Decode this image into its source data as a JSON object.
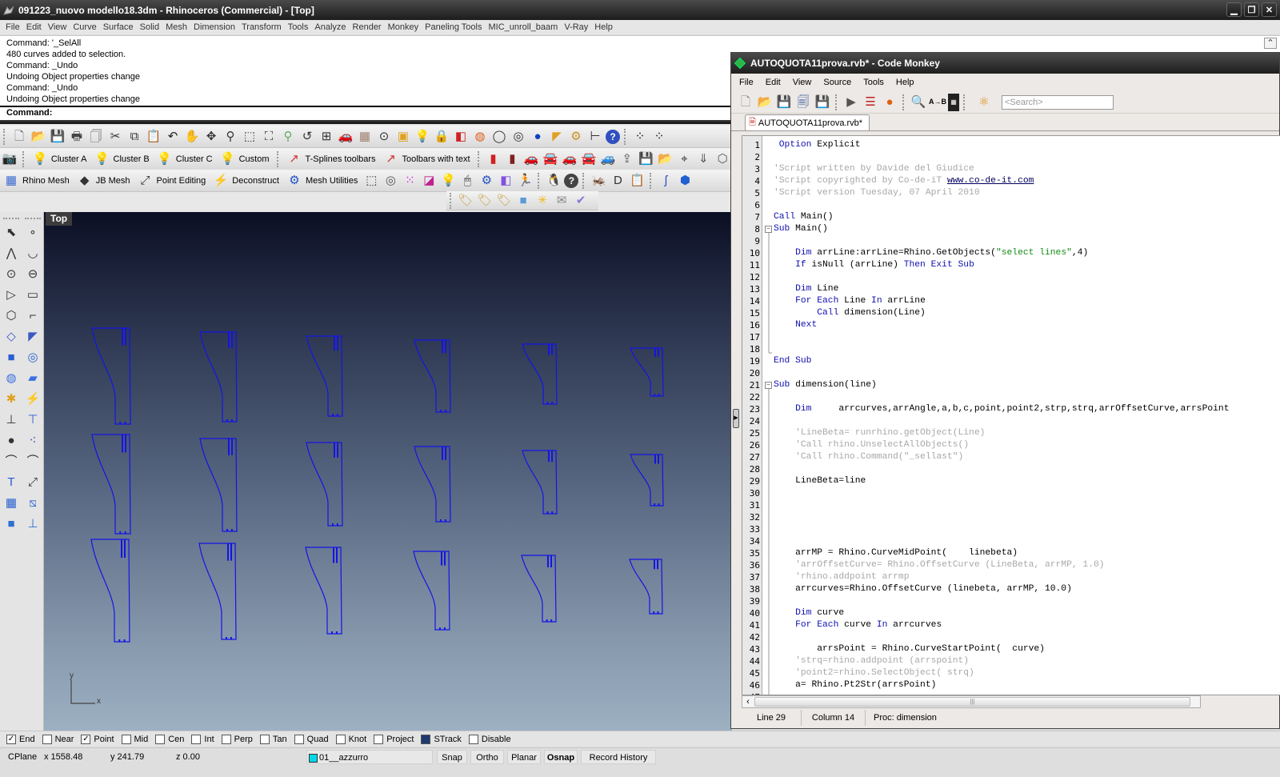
{
  "window": {
    "title": "091223_nuovo modello18.3dm - Rhinoceros (Commercial) - [Top]",
    "controls": [
      "minimize",
      "restore",
      "close"
    ]
  },
  "menu": [
    "File",
    "Edit",
    "View",
    "Curve",
    "Surface",
    "Solid",
    "Mesh",
    "Dimension",
    "Transform",
    "Tools",
    "Analyze",
    "Render",
    "Monkey",
    "Paneling Tools",
    "MIC_unroll_baam",
    "V-Ray",
    "Help"
  ],
  "command_history": [
    "Command: '_SelAll",
    "480 curves added to selection.",
    "Command: _Undo",
    "Undoing Object properties change",
    "Command: _Undo",
    "Undoing Object properties change"
  ],
  "command_prompt": "Command:",
  "toolbars": {
    "row1_icons": [
      "new-file",
      "open",
      "save",
      "print",
      "import",
      "cut",
      "copy",
      "paste",
      "undo",
      "pan",
      "rotate-view",
      "zoom-dynamic",
      "zoom-window",
      "zoom-extents",
      "zoom-selected",
      "undo-view",
      "four-viewports",
      "car",
      "grid",
      "osnap",
      "layer",
      "light-bulb",
      "lock",
      "shade",
      "color-wheel",
      "sphere-wire",
      "sphere-grid",
      "render-sphere",
      "flag",
      "gear",
      "dimension",
      "help"
    ],
    "row2_buttons": [
      {
        "icon": "bulb",
        "label": "Cluster A"
      },
      {
        "icon": "bulb",
        "label": "Cluster B"
      },
      {
        "icon": "bulb",
        "label": "Cluster C"
      },
      {
        "icon": "bulb",
        "label": "Custom"
      },
      {
        "icon": "tsplines",
        "label": "T-Splines toolbars"
      },
      {
        "icon": "tsplines",
        "label": "Toolbars with text"
      }
    ],
    "row3_buttons": [
      {
        "icon": "mesh-cube",
        "label": "Rhino Mesh"
      },
      {
        "icon": "jb-mesh",
        "label": "JB Mesh"
      },
      {
        "icon": "point-edit",
        "label": "Point Editing"
      },
      {
        "icon": "deconstruct",
        "label": "Deconstruct"
      },
      {
        "icon": "gears",
        "label": "Mesh Utilities"
      }
    ]
  },
  "viewport": {
    "label": "Top",
    "axis_x": "x",
    "axis_y": "y",
    "curve_color": "#1414e6",
    "grid_rows": 3,
    "grid_cols": 6
  },
  "osnaps": [
    {
      "label": "End",
      "checked": true
    },
    {
      "label": "Near",
      "checked": false
    },
    {
      "label": "Point",
      "checked": true
    },
    {
      "label": "Mid",
      "checked": false
    },
    {
      "label": "Cen",
      "checked": false
    },
    {
      "label": "Int",
      "checked": false
    },
    {
      "label": "Perp",
      "checked": false
    },
    {
      "label": "Tan",
      "checked": false
    },
    {
      "label": "Quad",
      "checked": false
    },
    {
      "label": "Knot",
      "checked": false
    },
    {
      "label": "Project",
      "checked": false
    },
    {
      "label": "STrack",
      "checked": true
    },
    {
      "label": "Disable",
      "checked": false
    }
  ],
  "status": {
    "cplane": "CPlane",
    "x": "x 1558.48",
    "y": "y 241.79",
    "z": "z 0.00",
    "layer": "01__azzurro",
    "layer_color": "#00d8e8",
    "snap": "Snap",
    "ortho": "Ortho",
    "planar": "Planar",
    "osnap": "Osnap",
    "record_history": "Record History"
  },
  "code_monkey": {
    "title": "AUTOQUOTA11prova.rvb* - Code Monkey",
    "menu": [
      "File",
      "Edit",
      "View",
      "Source",
      "Tools",
      "Help"
    ],
    "search_placeholder": "<Search>",
    "tab": "AUTOQUOTA11prova.rvb*",
    "status": {
      "line": "Line 29",
      "column": "Column 14",
      "proc": "Proc: dimension"
    },
    "lines": [
      {
        "n": "1",
        "tokens": [
          [
            " ",
            ""
          ],
          [
            "Option",
            "kw"
          ],
          [
            " Explicit",
            ""
          ]
        ]
      },
      {
        "n": "2",
        "tokens": []
      },
      {
        "n": "3",
        "tokens": [
          [
            "'Script written by Davide del Giudice",
            "cmt"
          ]
        ]
      },
      {
        "n": "4",
        "tokens": [
          [
            "'Script copyrighted by Co-de-iT ",
            "cmt"
          ],
          [
            "www.co-de-it.com",
            "lnk"
          ]
        ]
      },
      {
        "n": "5",
        "tokens": [
          [
            "'Script version Tuesday, 07 April 2010",
            "cmt"
          ]
        ]
      },
      {
        "n": "6",
        "tokens": []
      },
      {
        "n": "7",
        "tokens": [
          [
            "Call",
            "kw"
          ],
          [
            " Main()",
            ""
          ]
        ]
      },
      {
        "n": "8",
        "fold": true,
        "tokens": [
          [
            "Sub",
            "kw"
          ],
          [
            " Main()",
            ""
          ]
        ]
      },
      {
        "n": "9",
        "tokens": []
      },
      {
        "n": "10",
        "tokens": [
          [
            "    ",
            ""
          ],
          [
            "Dim",
            "kw"
          ],
          [
            " arrLine:arrLine=Rhino.GetObjects(",
            ""
          ],
          [
            "\"select lines\"",
            "str"
          ],
          [
            ",4)",
            ""
          ]
        ]
      },
      {
        "n": "11",
        "tokens": [
          [
            "    ",
            ""
          ],
          [
            "If",
            "kw"
          ],
          [
            " isNull (arrLine) ",
            ""
          ],
          [
            "Then Exit Sub",
            "kw"
          ]
        ]
      },
      {
        "n": "12",
        "tokens": []
      },
      {
        "n": "13",
        "tokens": [
          [
            "    ",
            ""
          ],
          [
            "Dim",
            "kw"
          ],
          [
            " Line",
            ""
          ]
        ]
      },
      {
        "n": "14",
        "tokens": [
          [
            "    ",
            ""
          ],
          [
            "For Each",
            "kw"
          ],
          [
            " Line ",
            ""
          ],
          [
            "In",
            "kw"
          ],
          [
            " arrLine",
            ""
          ]
        ]
      },
      {
        "n": "15",
        "tokens": [
          [
            "        ",
            ""
          ],
          [
            "Call",
            "kw"
          ],
          [
            " dimension(Line)",
            ""
          ]
        ]
      },
      {
        "n": "16",
        "tokens": [
          [
            "    ",
            ""
          ],
          [
            "Next",
            "kw"
          ]
        ]
      },
      {
        "n": "17",
        "tokens": []
      },
      {
        "n": "18",
        "tokens": []
      },
      {
        "n": "19",
        "tokens": [
          [
            "End Sub",
            "kw"
          ]
        ]
      },
      {
        "n": "20",
        "tokens": []
      },
      {
        "n": "21",
        "fold": true,
        "tokens": [
          [
            "Sub",
            "kw"
          ],
          [
            " dimension(line)",
            ""
          ]
        ]
      },
      {
        "n": "22",
        "tokens": []
      },
      {
        "n": "23",
        "tokens": [
          [
            "    ",
            ""
          ],
          [
            "Dim",
            "kw"
          ],
          [
            "     arrcurves,arrAngle,a,b,c,point,point2,strp,strq,arrOffsetCurve,arrsPoint",
            ""
          ]
        ]
      },
      {
        "n": "24",
        "tokens": []
      },
      {
        "n": "25",
        "tokens": [
          [
            "    ",
            ""
          ],
          [
            "'LineBeta= runrhino.getObject(Line)",
            "cmt"
          ]
        ]
      },
      {
        "n": "26",
        "tokens": [
          [
            "    ",
            ""
          ],
          [
            "'Call rhino.UnselectAllObjects()",
            "cmt"
          ]
        ]
      },
      {
        "n": "27",
        "tokens": [
          [
            "    ",
            ""
          ],
          [
            "'Call rhino.Command(\"_sellast\")",
            "cmt"
          ]
        ]
      },
      {
        "n": "28",
        "tokens": []
      },
      {
        "n": "29",
        "tokens": [
          [
            "    LineBeta=line",
            ""
          ]
        ]
      },
      {
        "n": "30",
        "tokens": []
      },
      {
        "n": "31",
        "tokens": []
      },
      {
        "n": "32",
        "tokens": []
      },
      {
        "n": "33",
        "tokens": []
      },
      {
        "n": "34",
        "tokens": []
      },
      {
        "n": "35",
        "tokens": [
          [
            "    arrMP = Rhino.CurveMidPoint(    linebeta)",
            ""
          ]
        ]
      },
      {
        "n": "36",
        "tokens": [
          [
            "    ",
            ""
          ],
          [
            "'arrOffsetCurve= Rhino.OffsetCurve (LineBeta, arrMP, 1.0)",
            "cmt"
          ]
        ]
      },
      {
        "n": "37",
        "tokens": [
          [
            "    ",
            ""
          ],
          [
            "'rhino.addpoint arrmp",
            "cmt"
          ]
        ]
      },
      {
        "n": "38",
        "tokens": [
          [
            "    arrcurves=Rhino.OffsetCurve (linebeta, arrMP, 10.0)",
            ""
          ]
        ]
      },
      {
        "n": "39",
        "tokens": []
      },
      {
        "n": "40",
        "tokens": [
          [
            "    ",
            ""
          ],
          [
            "Dim",
            "kw"
          ],
          [
            " curve",
            ""
          ]
        ]
      },
      {
        "n": "41",
        "tokens": [
          [
            "    ",
            ""
          ],
          [
            "For Each",
            "kw"
          ],
          [
            " curve ",
            ""
          ],
          [
            "In",
            "kw"
          ],
          [
            " arrcurves",
            ""
          ]
        ]
      },
      {
        "n": "42",
        "tokens": []
      },
      {
        "n": "43",
        "tokens": [
          [
            "        arrsPoint = Rhino.CurveStartPoint(  curve)",
            ""
          ]
        ]
      },
      {
        "n": "44",
        "tokens": [
          [
            "    ",
            ""
          ],
          [
            "'strq=rhino.addpoint (arrspoint)",
            "cmt"
          ]
        ]
      },
      {
        "n": "45",
        "tokens": [
          [
            "    ",
            ""
          ],
          [
            "'point2=rhino.SelectObject( strq)",
            "cmt"
          ]
        ]
      },
      {
        "n": "46",
        "tokens": [
          [
            "    a= Rhino.Pt2Str(arrsPoint)",
            ""
          ]
        ]
      },
      {
        "n": "47",
        "tokens": []
      }
    ]
  }
}
